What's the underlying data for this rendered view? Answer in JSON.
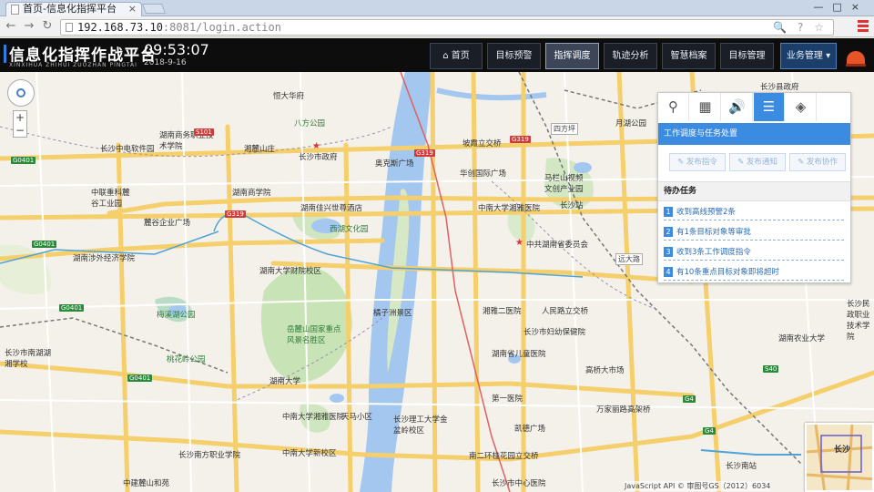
{
  "browser": {
    "tab_title": "首页-信息化指挥平台",
    "tab_close": "×",
    "window_controls": "—□×",
    "url_host": "192.168.73.10",
    "url_path": ":8081/login.action",
    "back_icon": "arrow-left",
    "forward_icon": "arrow-right",
    "reload_icon": "reload",
    "omni_icons": "🔍 ? ☆"
  },
  "app": {
    "title": "信息化指挥作战平台",
    "pinyin": "XINXIHUA ZHIHUI ZUOZHAN PINGTAI",
    "clock": "09:53:07",
    "date": "2018-9-16",
    "nav": [
      {
        "label": "⌂ 首页"
      },
      {
        "label": "目标预警"
      },
      {
        "label": "指挥调度"
      },
      {
        "label": "轨迹分析"
      },
      {
        "label": "智慧档案"
      },
      {
        "label": "目标管理"
      },
      {
        "label": "业务管理 ▾"
      }
    ],
    "active_nav": "指挥调度",
    "accent_color": "#3b8be0"
  },
  "panel": {
    "tool_icons": [
      "search-icon",
      "grid-icon",
      "speaker-icon",
      "layers-list-icon",
      "stack-icon"
    ],
    "tool_glyphs": [
      "⚲",
      "▦",
      "🔊",
      "☰",
      "◈"
    ],
    "header": "工作调度与任务处置",
    "buttons": [
      "✎ 发布指令",
      "✎ 发布通知",
      "✎ 发布协作"
    ],
    "task_title": "待办任务",
    "tasks": [
      {
        "num": "1",
        "text": "收到高线预警2条"
      },
      {
        "num": "2",
        "text": "有1条目标对象等审批"
      },
      {
        "num": "3",
        "text": "收到3条工作调度指令"
      },
      {
        "num": "4",
        "text": "有10条重点目标对象即将超时"
      }
    ]
  },
  "map": {
    "labels": [
      "恒大华府",
      "八方公园",
      "长沙中电软件园",
      "湖南商务职业技术学院",
      "湘麓山庄",
      "长沙市政府",
      "奥克斯广场",
      "湖南商学院",
      "湖南佳兴世尊酒店",
      "西湖文化园",
      "中联重科麓谷工业园",
      "麓谷企业广场",
      "湖南涉外经济学院",
      "湖南大学财院校区",
      "梅溪湖公园",
      "岳麓山国家重点风景名胜区",
      "橘子洲景区",
      "湖南大学",
      "桃花岭公园",
      "中南大学",
      "中南大学湘雅医院",
      "长沙南方职业学院",
      "天马小区",
      "长沙理工大学金盆岭校区",
      "金盆岭",
      "中南大学新校区",
      "湘雅二医院",
      "人民路立交桥",
      "长沙市妇幼保健院",
      "湖南省儿童医院",
      "第一医院",
      "凯德广场",
      "高桥大市场",
      "万家丽路高架桥",
      "南二环桂花园立交桥",
      "长沙市中心医院",
      "长沙南站",
      "中共湖南省委员会",
      "中南大学湘雅医院",
      "华创国际广场",
      "坡霞立交桥",
      "开福区",
      "长沙站",
      "芙蓉区",
      "长沙县政府",
      "马栏山视频文创产业园",
      "四方坪",
      "月湖公园",
      "湖南农业大学",
      "远大路",
      "长沙民政职业技术学院",
      "长沙市南湖湖湘学校",
      "中建麓山和苑",
      "湖南涉外经济学院"
    ],
    "road_shields": [
      "S101",
      "G319",
      "G319",
      "G319",
      "G0401",
      "G0401",
      "G0401",
      "G4",
      "G4",
      "S40",
      "G0401"
    ],
    "overview_label": "长沙",
    "copyright": "JavaScript API © 审图号GS（2012）6034"
  }
}
